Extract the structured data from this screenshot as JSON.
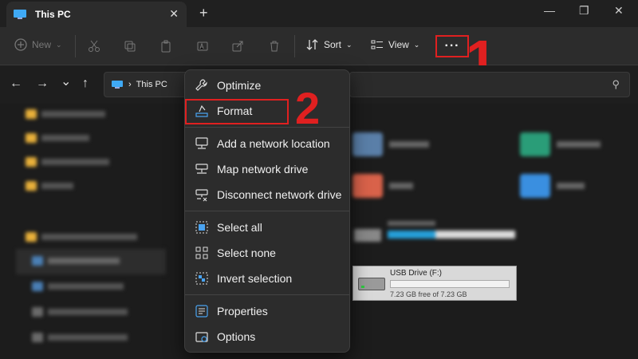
{
  "window": {
    "tab_title": "This PC",
    "new_tab": "+",
    "close_tab": "✕",
    "minimize": "—",
    "maximize": "❐",
    "close": "✕"
  },
  "toolbar": {
    "new_label": "New",
    "sort_label": "Sort",
    "view_label": "View",
    "more_label": "···",
    "step1_marker": "1"
  },
  "navbar": {
    "back": "←",
    "forward": "→",
    "recent": "⌄",
    "up": "↑",
    "breadcrumb_sep": "›",
    "location": "This PC"
  },
  "menu": {
    "items": [
      {
        "label": "Optimize",
        "icon": "wrench-icon"
      },
      {
        "label": "Format",
        "icon": "format-drive-icon"
      },
      {
        "label": "Add a network location",
        "icon": "network-location-icon"
      },
      {
        "label": "Map network drive",
        "icon": "map-network-drive-icon"
      },
      {
        "label": "Disconnect network drive",
        "icon": "disconnect-drive-icon"
      },
      {
        "label": "Select all",
        "icon": "select-all-icon"
      },
      {
        "label": "Select none",
        "icon": "select-none-icon"
      },
      {
        "label": "Invert selection",
        "icon": "invert-selection-icon"
      },
      {
        "label": "Properties",
        "icon": "properties-icon"
      },
      {
        "label": "Options",
        "icon": "options-icon"
      }
    ],
    "step2_marker": "2"
  },
  "usb_drive": {
    "name": "USB Drive (F:)",
    "free_text": "7.23 GB free of 7.23 GB",
    "used_fraction": 0.0
  },
  "colors": {
    "annotation_red": "#e02020",
    "accent_blue": "#26a0da"
  }
}
